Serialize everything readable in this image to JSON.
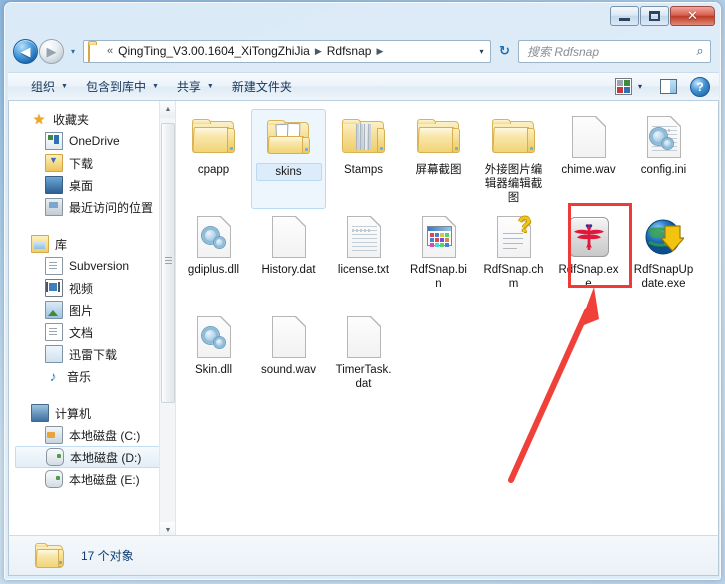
{
  "window": {
    "controls": {
      "minimize_label": "Minimize",
      "maximize_label": "Maximize",
      "close_label": "✕"
    }
  },
  "address": {
    "back_glyph": "◀",
    "forward_glyph": "▶",
    "history_glyph": "▾",
    "chevrons": "«",
    "crumbs": [
      {
        "label": "QingTing_V3.00.1604_XiTongZhiJia",
        "sep": "▶"
      },
      {
        "label": "Rdfsnap",
        "sep": "▶"
      }
    ],
    "dropdown_glyph": "▾",
    "refresh_glyph": "↻",
    "folder_icon": "folder-icon"
  },
  "search": {
    "placeholder": "搜索 Rdfsnap",
    "icon": "search-icon",
    "icon_glyph": "⌕"
  },
  "toolbar": {
    "items": [
      {
        "label": "组织",
        "has_caret": true
      },
      {
        "label": "包含到库中",
        "has_caret": true
      },
      {
        "label": "共享",
        "has_caret": true
      },
      {
        "label": "新建文件夹",
        "has_caret": false
      }
    ],
    "view_dropdown_glyph": "▾",
    "help_glyph": "?"
  },
  "sidebar": {
    "groups": [
      {
        "header": {
          "label": "收藏夹",
          "icon": "star-icon"
        },
        "items": [
          {
            "label": "OneDrive",
            "icon": "onedrive-icon"
          },
          {
            "label": "下载",
            "icon": "download-folder-icon"
          },
          {
            "label": "桌面",
            "icon": "desktop-icon"
          },
          {
            "label": "最近访问的位置",
            "icon": "recent-places-icon"
          }
        ]
      },
      {
        "header": {
          "label": "库",
          "icon": "library-icon"
        },
        "items": [
          {
            "label": "Subversion",
            "icon": "document-icon"
          },
          {
            "label": "视频",
            "icon": "video-icon"
          },
          {
            "label": "图片",
            "icon": "picture-icon"
          },
          {
            "label": "文档",
            "icon": "document-icon"
          },
          {
            "label": "迅雷下载",
            "icon": "thunder-download-icon"
          },
          {
            "label": "音乐",
            "icon": "music-icon"
          }
        ]
      },
      {
        "header": {
          "label": "计算机",
          "icon": "computer-icon"
        },
        "items": [
          {
            "label": "本地磁盘 (C:)",
            "icon": "system-drive-icon",
            "selected": false
          },
          {
            "label": "本地磁盘 (D:)",
            "icon": "drive-icon",
            "selected": true
          },
          {
            "label": "本地磁盘 (E:)",
            "icon": "drive-icon",
            "selected": false
          }
        ]
      }
    ],
    "scrollbar": {
      "up_glyph": "▲",
      "down_glyph": "▼"
    }
  },
  "files": {
    "rows": [
      [
        {
          "name": "cpapp",
          "icon": "folder",
          "selected": false
        },
        {
          "name": "skins",
          "icon": "folder-sheets",
          "selected": true
        },
        {
          "name": "Stamps",
          "icon": "folder-stripes",
          "selected": false
        },
        {
          "name": "屏幕截图",
          "icon": "folder",
          "selected": false
        },
        {
          "name": "外接图片编辑器编辑截图",
          "icon": "folder",
          "selected": false
        },
        {
          "name": "chime.wav",
          "icon": "page",
          "selected": false
        },
        {
          "name": "config.ini",
          "icon": "ini",
          "selected": false
        }
      ],
      [
        {
          "name": "gdiplus.dll",
          "icon": "dll",
          "selected": false
        },
        {
          "name": "History.dat",
          "icon": "page",
          "selected": false
        },
        {
          "name": "license.txt",
          "icon": "txt",
          "selected": false
        },
        {
          "name": "RdfSnap.bin",
          "icon": "bin",
          "selected": false
        },
        {
          "name": "RdfSnap.chm",
          "icon": "chm",
          "selected": false
        },
        {
          "name": "RdfSnap.exe",
          "icon": "exe-dragonfly",
          "selected": false
        },
        {
          "name": "RdfSnapUpdate.exe",
          "icon": "exe-globe",
          "selected": false
        }
      ],
      [
        {
          "name": "Skin.dll",
          "icon": "dll",
          "selected": false
        },
        {
          "name": "sound.wav",
          "icon": "page",
          "selected": false
        },
        {
          "name": "TimerTask.dat",
          "icon": "page",
          "selected": false
        }
      ]
    ]
  },
  "annotations": {
    "highlight_color": "#ef3b35",
    "arrow_color": "#f0403a",
    "highlight_target": "RdfSnap.exe"
  },
  "status": {
    "text": "17 个对象",
    "icon": "folder-icon"
  }
}
